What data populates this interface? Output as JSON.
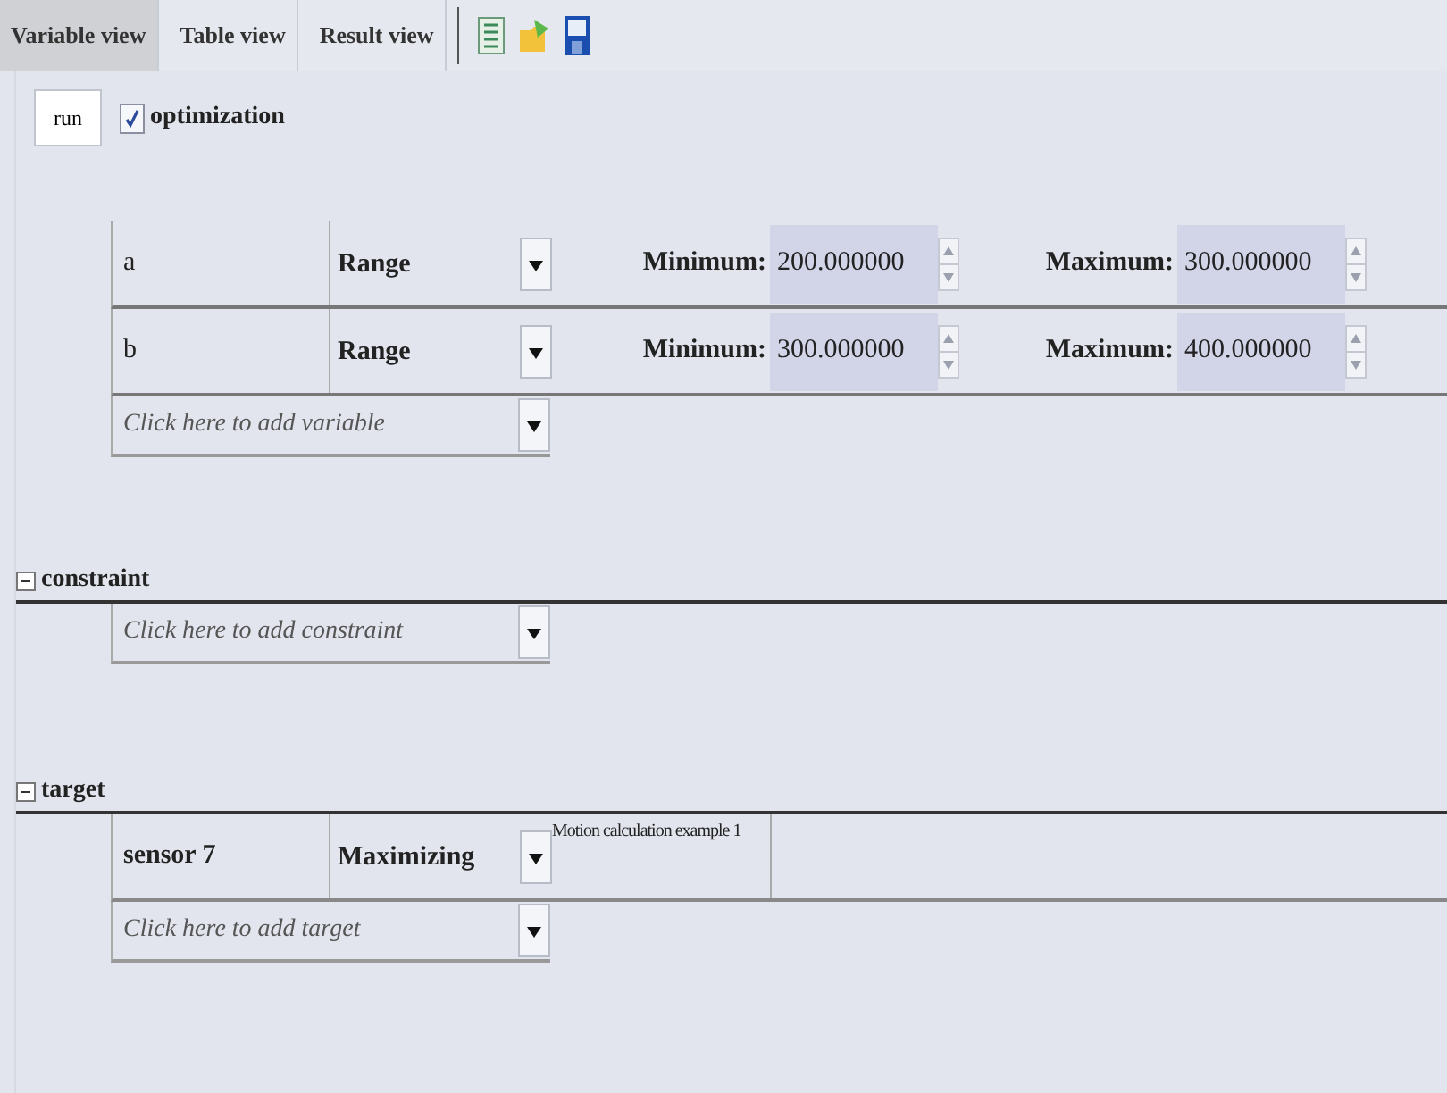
{
  "tabs": [
    {
      "label": "Variable view",
      "selected": true
    },
    {
      "label": "Table view",
      "selected": false
    },
    {
      "label": "Result view",
      "selected": false
    }
  ],
  "run_button": "run",
  "optimization": {
    "label": "optimization",
    "checked": true
  },
  "variables": {
    "rows": [
      {
        "name": "a",
        "type": "Range",
        "min_label": "Minimum:",
        "min": "200.000000",
        "max_label": "Maximum:",
        "max": "300.000000"
      },
      {
        "name": "b",
        "type": "Range",
        "min_label": "Minimum:",
        "min": "300.000000",
        "max_label": "Maximum:",
        "max": "400.000000"
      }
    ],
    "add_placeholder": "Click here to add variable"
  },
  "constraint": {
    "title": "constraint",
    "expanded": true,
    "add_placeholder": "Click here to add  constraint"
  },
  "target": {
    "title": "target",
    "expanded": true,
    "rows": [
      {
        "name": "sensor 7",
        "type": "Maximizing",
        "description": "Motion calculation example 1"
      }
    ],
    "add_placeholder": "Click here to add  target"
  }
}
